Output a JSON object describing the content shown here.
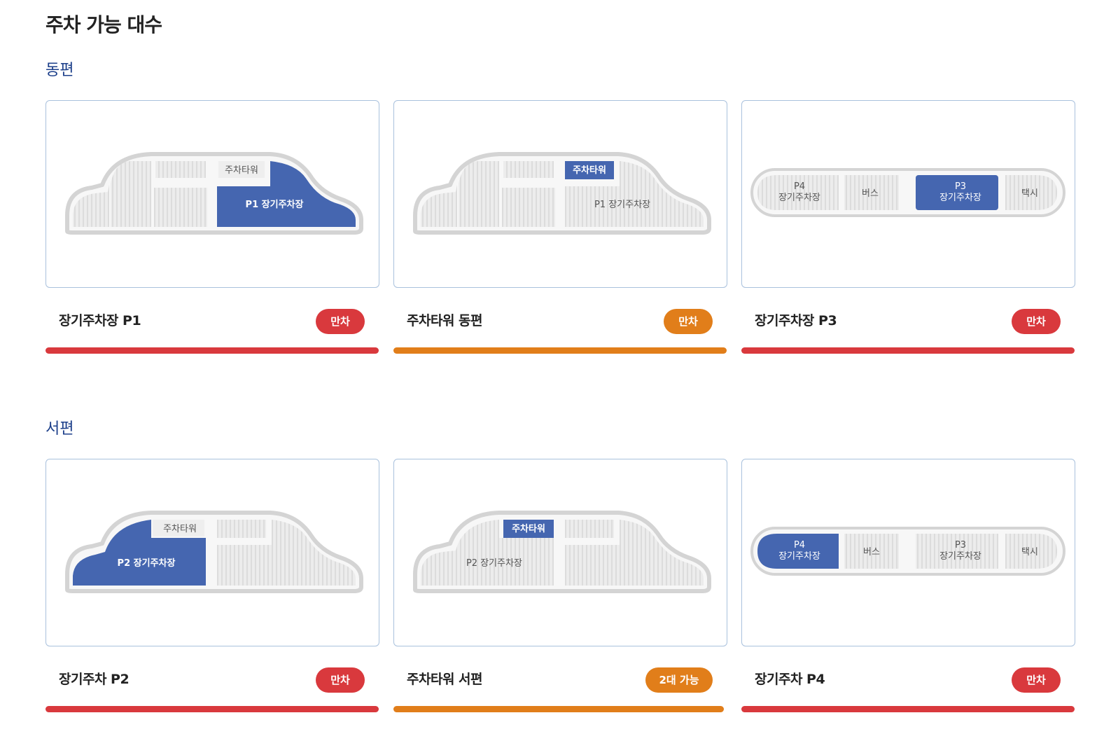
{
  "page": {
    "title": "주차 가능 대수"
  },
  "sections": [
    {
      "title": "동편",
      "cards": [
        {
          "name": "장기주차장 P1",
          "status": "만차",
          "map": {
            "tower_label": "주차타워",
            "lot_label": "P1 장기주차장"
          }
        },
        {
          "name": "주차타워 동편",
          "status": "만차",
          "map": {
            "tower_label": "주차타워",
            "lot_label": "P1 장기주차장"
          }
        },
        {
          "name": "장기주차장 P3",
          "status": "만차",
          "map": {
            "p4_line1": "P4",
            "p4_line2": "장기주차장",
            "bus": "버스",
            "p3_line1": "P3",
            "p3_line2": "장기주차장",
            "taxi": "택시"
          }
        }
      ]
    },
    {
      "title": "서편",
      "cards": [
        {
          "name": "장기주차 P2",
          "status": "만차",
          "map": {
            "tower_label": "주차타워",
            "lot_label": "P2 장기주차장"
          }
        },
        {
          "name": "주차타워 서편",
          "status": "2대 가능",
          "map": {
            "tower_label": "주차타워",
            "lot_label": "P2 장기주차장"
          }
        },
        {
          "name": "장기주차 P4",
          "status": "만차",
          "map": {
            "p4_line1": "P4",
            "p4_line2": "장기주차장",
            "bus": "버스",
            "p3_line1": "P3",
            "p3_line2": "장기주차장",
            "taxi": "택시"
          }
        }
      ]
    }
  ],
  "colors": {
    "highlight": "#4566b0",
    "full_red": "#d9393d",
    "orange": "#e17e1a",
    "section_blue": "#1c3f8a",
    "border": "#a9c1dd"
  }
}
